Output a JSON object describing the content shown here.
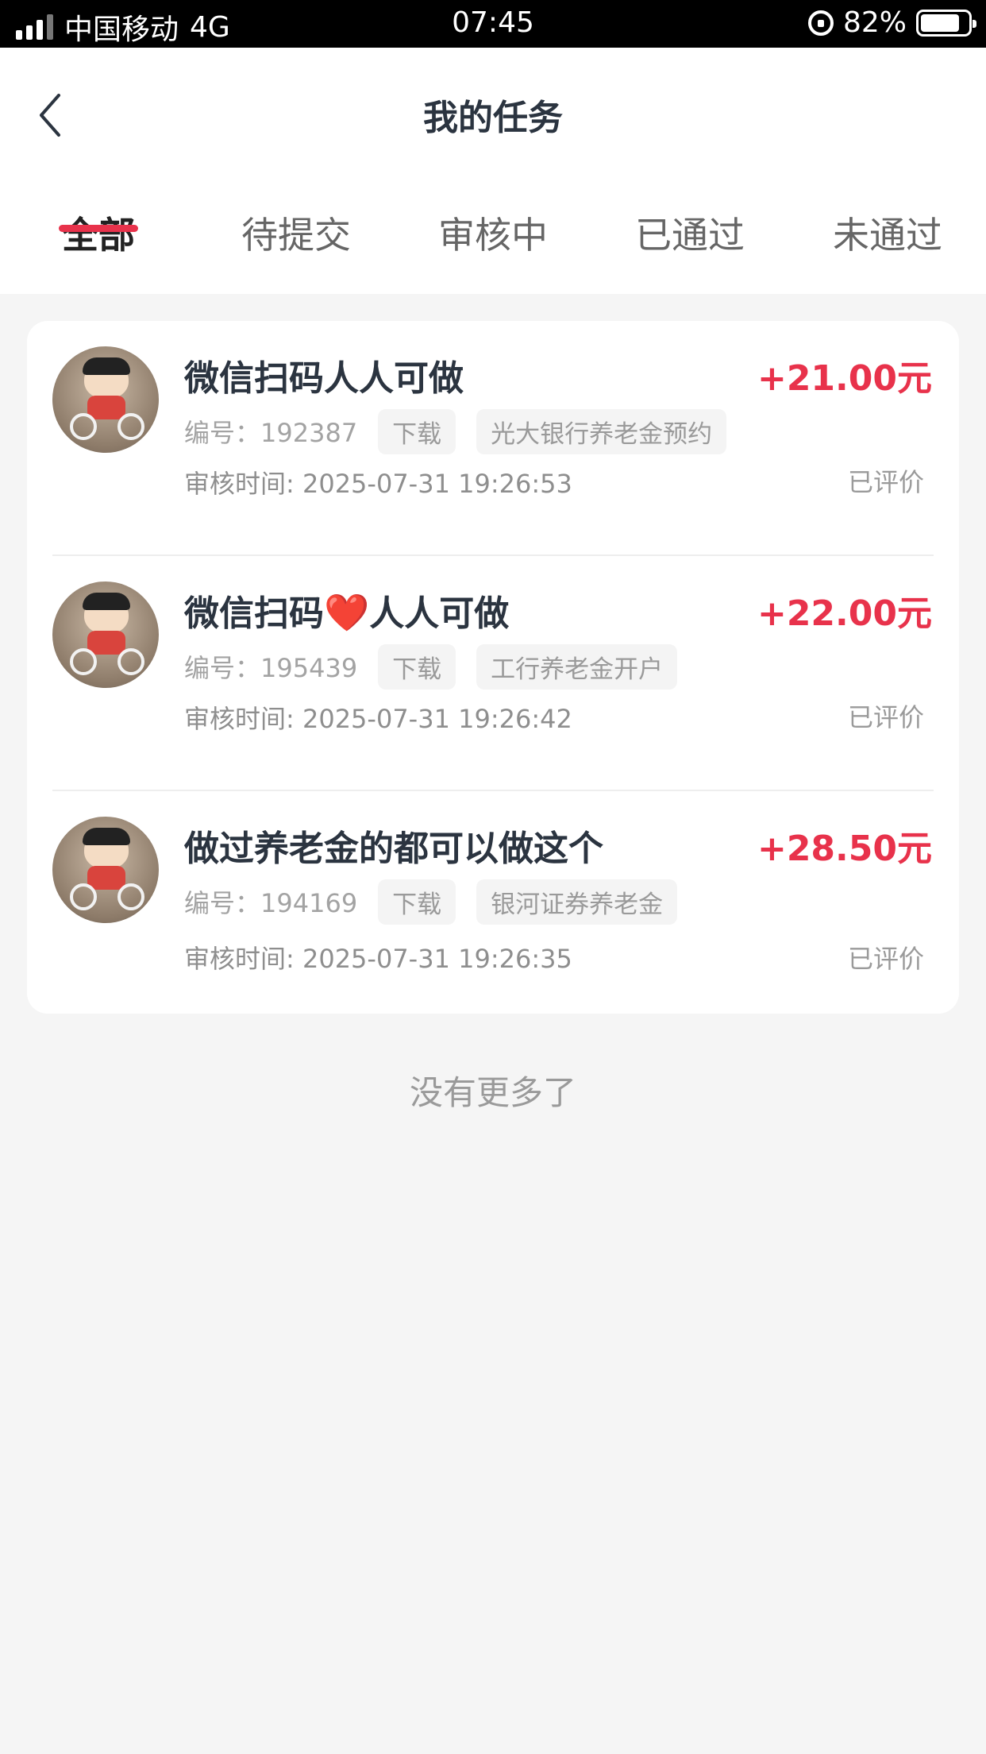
{
  "status_bar": {
    "carrier": "中国移动",
    "network": "4G",
    "time": "07:45",
    "battery": "82%",
    "battery_level": 0.82
  },
  "header": {
    "title": "我的任务",
    "back_icon": "chevron-left-icon"
  },
  "tabs": [
    {
      "label": "全部",
      "active": true
    },
    {
      "label": "待提交",
      "active": false
    },
    {
      "label": "审核中",
      "active": false
    },
    {
      "label": "已通过",
      "active": false
    },
    {
      "label": "未通过",
      "active": false
    }
  ],
  "colors": {
    "accent": "#e8324b"
  },
  "tasks": [
    {
      "title": "微信扫码人人可做",
      "title_a": "微信扫码",
      "title_b": "人人可做",
      "has_heart": false,
      "amount": "+21.00元",
      "id_label": "编号：",
      "id": "192387",
      "tags": [
        "下载",
        "光大银行养老金预约"
      ],
      "review_label": "审核时间:",
      "review_time": "2025-07-31 19:26:53",
      "status": "已评价"
    },
    {
      "title_a": "微信扫码",
      "heart": "❤️",
      "title_b": "人人可做",
      "has_heart": true,
      "amount": "+22.00元",
      "id_label": "编号：",
      "id": "195439",
      "tags": [
        "下载",
        "工行养老金开户"
      ],
      "review_label": "审核时间:",
      "review_time": "2025-07-31 19:26:42",
      "status": "已评价"
    },
    {
      "title": "做过养老金的都可以做这个",
      "has_heart": false,
      "amount": "+28.50元",
      "id_label": "编号：",
      "id": "194169",
      "tags": [
        "下载",
        "银河证券养老金"
      ],
      "review_label": "审核时间:",
      "review_time": "2025-07-31 19:26:35",
      "status": "已评价"
    }
  ],
  "footer": {
    "no_more": "没有更多了"
  }
}
